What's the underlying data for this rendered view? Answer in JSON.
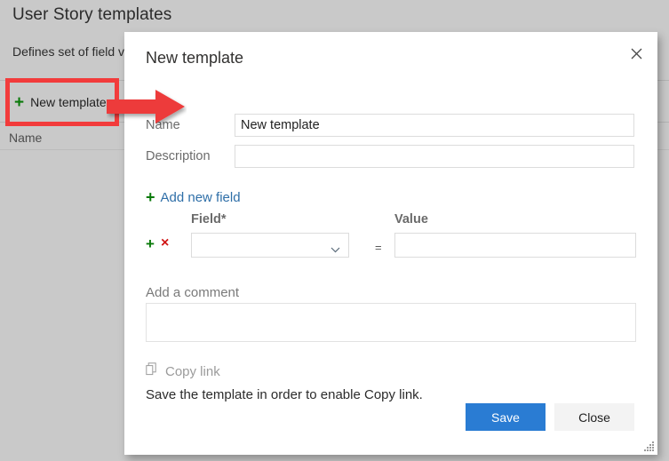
{
  "background": {
    "title": "User Story templates",
    "subtitle": "Defines set of field v",
    "new_template_button": "New template",
    "new_template_plus": "+",
    "column_header_name": "Name"
  },
  "annotation": {
    "box_color": "#f23b3b",
    "arrow_color": "#ed3b3b"
  },
  "dialog": {
    "title": "New template",
    "close_icon": "close-icon",
    "fields": {
      "name_label": "Name",
      "name_value": "New template",
      "name_placeholder": "",
      "description_label": "Description",
      "description_value": "",
      "description_placeholder": ""
    },
    "add_new_field": {
      "plus": "+",
      "label": "Add new field"
    },
    "field_table": {
      "header_field": "Field*",
      "header_value": "Value",
      "row": {
        "add_icon": "+",
        "remove_icon": "×",
        "select_value": "",
        "select_chevron": "chevron-down-icon",
        "equals": "=",
        "value_input": "",
        "value_placeholder": ""
      }
    },
    "comment": {
      "label": "Add a comment",
      "value": "",
      "placeholder": ""
    },
    "copy_link": {
      "icon": "copy-icon",
      "label": "Copy link",
      "hint": "Save the template in order to enable Copy link."
    },
    "buttons": {
      "save": "Save",
      "close": "Close",
      "save_color": "#2a7cd3",
      "close_color": "#f3f3f3"
    },
    "resize_grip": "resize-grip-icon"
  }
}
